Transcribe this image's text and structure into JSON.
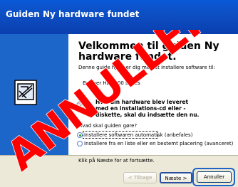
{
  "window": {
    "title": "Guiden Ny hardware fundet"
  },
  "main": {
    "heading": "Velkommen til guiden Ny hardware fundet.",
    "intro": "Denne guide hjælper dig med at installere software til:",
    "device": "Brother HL-5000 series",
    "cd_hint": "Hvis din hardware blev leveret med en installations-cd eller -diskette, skal du indsætte den nu.",
    "question": "Hvad skal guiden gøre?",
    "options": [
      {
        "label": "Installere softwaren automatisk (anbefales)",
        "selected": true
      },
      {
        "label": "Installere fra en liste eller en bestemt placering (avanceret)",
        "selected": false
      }
    ],
    "continue_hint": "Klik på Næste for at fortsætte."
  },
  "buttons": {
    "back": "< Tilbage",
    "next": "Næste >",
    "cancel": "Annuller"
  },
  "watermark": {
    "text": "ANNULLER",
    "color": "#ff0000"
  },
  "colors": {
    "titlebar": "#0a58d6",
    "side_panel": "#1d66c9",
    "highlight": "#1e63c8"
  }
}
